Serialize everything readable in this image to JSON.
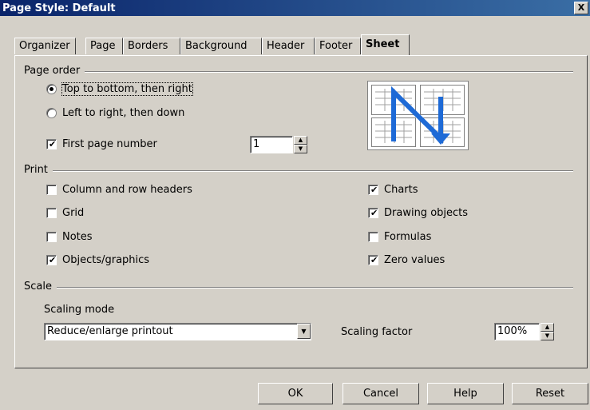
{
  "window": {
    "title": "Page Style: Default",
    "close_label": "X"
  },
  "tabs": [
    "Organizer",
    "Page",
    "Borders",
    "Background",
    "Header",
    "Footer",
    "Sheet"
  ],
  "active_tab": "Sheet",
  "page_order": {
    "label": "Page order",
    "options": [
      {
        "label": "Top to bottom, then right",
        "selected": true
      },
      {
        "label": "Left to right, then down",
        "selected": false
      }
    ],
    "first_page_number": {
      "label": "First page number",
      "checked": true,
      "value": "1"
    }
  },
  "print": {
    "label": "Print",
    "left": [
      {
        "label": "Column and row headers",
        "checked": false
      },
      {
        "label": "Grid",
        "checked": false
      },
      {
        "label": "Notes",
        "checked": false
      },
      {
        "label": "Objects/graphics",
        "checked": true
      }
    ],
    "right": [
      {
        "label": "Charts",
        "checked": true
      },
      {
        "label": "Drawing objects",
        "checked": true
      },
      {
        "label": "Formulas",
        "checked": false
      },
      {
        "label": "Zero values",
        "checked": true
      }
    ]
  },
  "scale": {
    "label": "Scale",
    "mode_label": "Scaling mode",
    "mode_value": "Reduce/enlarge printout",
    "factor_label": "Scaling factor",
    "factor_value": "100%"
  },
  "buttons": {
    "ok": "OK",
    "cancel": "Cancel",
    "help": "Help",
    "reset": "Reset"
  },
  "colors": {
    "titlebar": "#0a246a",
    "dialog_bg": "#d4d0c8",
    "preview_arrow": "#1e6ad6"
  }
}
